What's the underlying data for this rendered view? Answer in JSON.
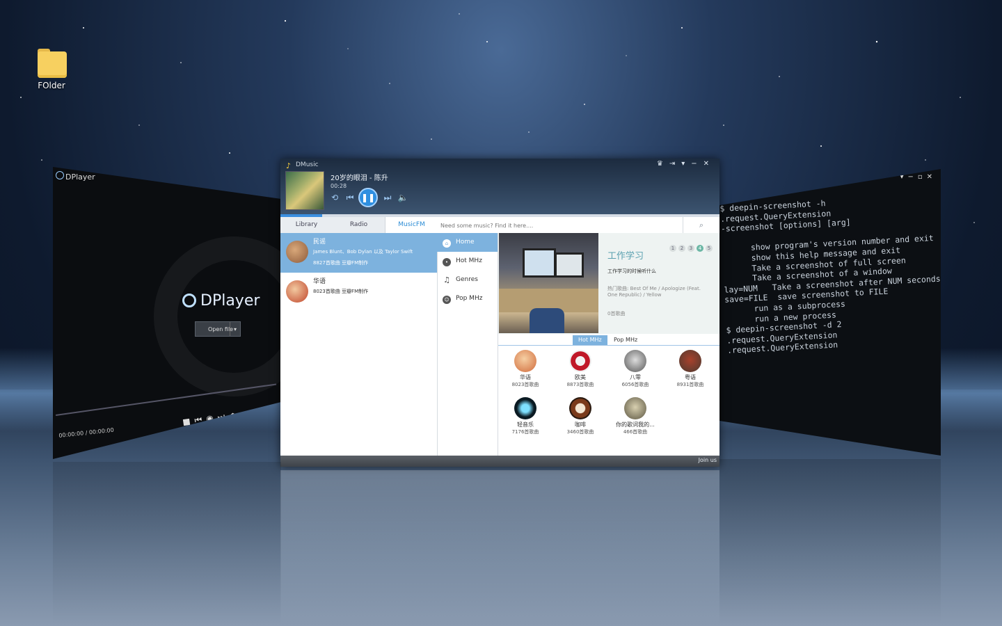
{
  "desktop": {
    "icon_label": "FOlder"
  },
  "dplayer": {
    "title": "DPlayer",
    "logo": "DPlayer",
    "open_file": "Open file",
    "time": "00:00:00 / 00:00:00"
  },
  "terminal": {
    "lines": [
      "$ deepin-screenshot -h",
      ".request.QueryExtension",
      "-screenshot [options] [arg]",
      "",
      "      show program's version number and exit",
      "      show this help message and exit",
      "      Take a screenshot of full screen",
      "      Take a screenshot of a window",
      "lay=NUM   Take a screenshot after NUM seconds",
      "save=FILE  save screenshot to FILE",
      "      run as a subprocess",
      "      run a new process",
      "$ deepin-screenshot -d 2",
      ".request.QueryExtension",
      ".request.QueryExtension"
    ]
  },
  "dmusic": {
    "title": "DMusic",
    "song": "20岁的眼泪 - 陈升",
    "elapsed": "00:28",
    "accent": "#7db2de",
    "tabs": [
      "Library",
      "Radio",
      "MusicFM"
    ],
    "search_placeholder": "Need some music? Find it here....",
    "stations": [
      {
        "name": "民谣",
        "desc": "James Blunt、Bob Dylan 以及 Taylor Swift",
        "meta": "8827首歌曲 豆瓣FM制作"
      },
      {
        "name": "华语",
        "desc": "",
        "meta": "8023首歌曲 豆瓣FM制作"
      }
    ],
    "nav": [
      {
        "label": "Home",
        "icon": "home-icon"
      },
      {
        "label": "Hot MHz",
        "icon": "hot-icon"
      },
      {
        "label": "Genres",
        "icon": "music-note-icon"
      },
      {
        "label": "Pop MHz",
        "icon": "smile-icon"
      }
    ],
    "feature": {
      "title": "工作学习",
      "subtitle": "工作学习的时候听什么",
      "hot": "热门歌曲: Best Of Me / Apologize (Feat. One Republic) / Yellow",
      "count": "0首歌曲",
      "pages": [
        "1",
        "2",
        "3",
        "4",
        "5"
      ],
      "active_page": 4
    },
    "subtabs": [
      "Hot MHz",
      "Pop MHz"
    ],
    "grid": [
      {
        "name": "华语",
        "meta": "8023首歌曲"
      },
      {
        "name": "欧美",
        "meta": "8873首歌曲"
      },
      {
        "name": "八零",
        "meta": "6056首歌曲"
      },
      {
        "name": "粤语",
        "meta": "8931首歌曲"
      },
      {
        "name": "轻音乐",
        "meta": "7176首歌曲"
      },
      {
        "name": "咖啡",
        "meta": "3460首歌曲"
      },
      {
        "name": "你的歌词我的...",
        "meta": "466首歌曲"
      }
    ],
    "join": "Join us"
  }
}
